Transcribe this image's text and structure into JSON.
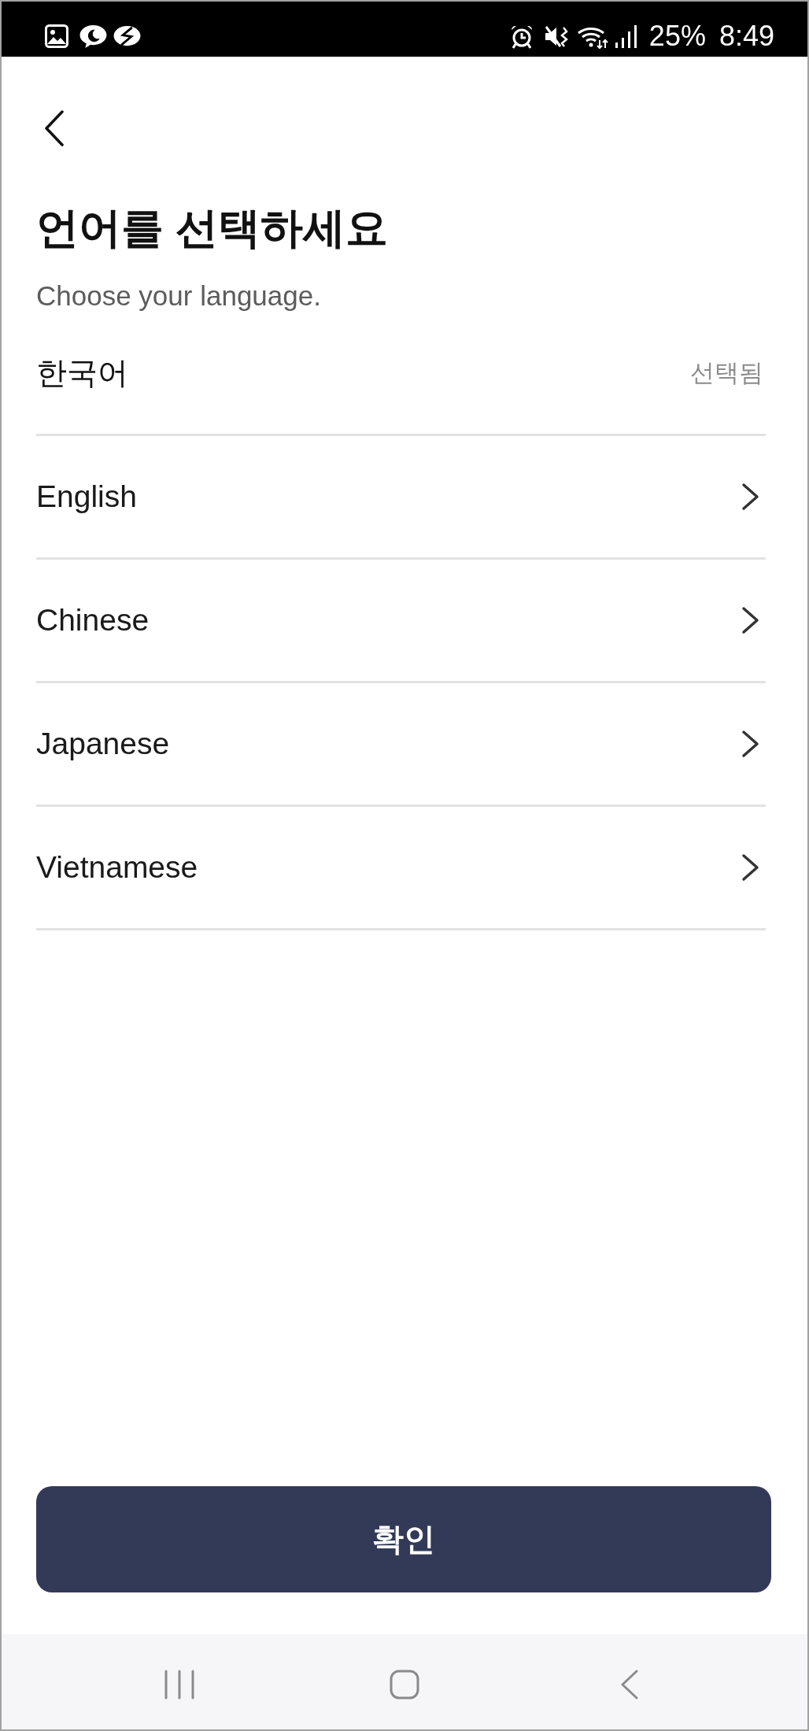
{
  "status_bar": {
    "battery": "25%",
    "time": "8:49"
  },
  "header": {
    "title": "언어를 선택하세요",
    "subtitle": "Choose your language."
  },
  "languages": [
    {
      "label": "한국어",
      "selected": true,
      "status": "선택됨"
    },
    {
      "label": "English",
      "selected": false
    },
    {
      "label": "Chinese",
      "selected": false
    },
    {
      "label": "Japanese",
      "selected": false
    },
    {
      "label": "Vietnamese",
      "selected": false
    }
  ],
  "confirm_button": {
    "label": "확인"
  }
}
